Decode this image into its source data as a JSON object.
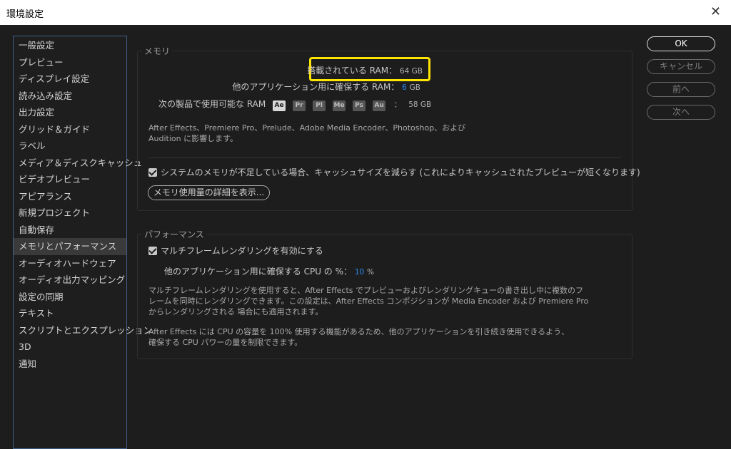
{
  "window": {
    "title": "環境設定"
  },
  "sidebar": {
    "items": [
      {
        "label": "一般設定"
      },
      {
        "label": "プレビュー"
      },
      {
        "label": "ディスプレイ設定"
      },
      {
        "label": "読み込み設定"
      },
      {
        "label": "出力設定"
      },
      {
        "label": "グリッド＆ガイド"
      },
      {
        "label": "ラベル"
      },
      {
        "label": "メディア＆ディスクキャッシュ"
      },
      {
        "label": "ビデオプレビュー"
      },
      {
        "label": "アピアランス"
      },
      {
        "label": "新規プロジェクト"
      },
      {
        "label": "自動保存"
      },
      {
        "label": "メモリとパフォーマンス",
        "selected": true
      },
      {
        "label": "オーディオハードウェア"
      },
      {
        "label": "オーディオ出力マッピング"
      },
      {
        "label": "設定の同期"
      },
      {
        "label": "テキスト"
      },
      {
        "label": "スクリプトとエクスプレッション"
      },
      {
        "label": "3D"
      },
      {
        "label": "通知"
      }
    ]
  },
  "memory": {
    "group_label": "メモリ",
    "installed_ram_label": "搭載されている RAM：",
    "installed_ram_value": "64 GB",
    "reserved_label": "他のアプリケーション用に確保する RAM：",
    "reserved_value": "6",
    "reserved_unit": "GB",
    "available_label": "次の製品で使用可能な RAM",
    "apps": [
      "Ae",
      "Pr",
      "Pl",
      "Me",
      "Ps",
      "Au"
    ],
    "available_sep": "：",
    "available_value": "58 GB",
    "note_line1": "After Effects、Premiere Pro、Prelude、Adobe Media Encoder、Photoshop、および",
    "note_line2": "Audition に影響します。",
    "cache_checkbox_label": "システムのメモリが不足している場合、キャッシュサイズを減らす (これによりキャッシュされたプレビューが短くなります)",
    "details_button": "メモリ使用量の詳細を表示..."
  },
  "performance": {
    "group_label": "パフォーマンス",
    "multiframe_checkbox_label": "マルチフレームレンダリングを有効にする",
    "cpu_label": "他のアプリケーション用に確保する CPU の %：",
    "cpu_value": "10",
    "cpu_unit": "%",
    "para1_line1": "マルチフレームレンダリングを使用すると、After Effects でプレビューおよびレンダリングキューの書き出し中に複数のフ",
    "para1_line2": "レームを同時にレンダリングできます。この設定は、After Effects コンポジションが Media Encoder および Premiere Pro",
    "para1_line3": "からレンダリングされる 場合にも適用されます。",
    "para2_line1": "After Effects には CPU の容量を 100% 使用する機能があるため、他のアプリケーションを引き続き使用できるよう、",
    "para2_line2": "確保する CPU パワーの量を制限できます。"
  },
  "buttons": {
    "ok": "OK",
    "cancel": "キャンセル",
    "prev": "前へ",
    "next": "次へ"
  },
  "colors": {
    "highlight": "#ffe500",
    "accent_value": "#2a8af0",
    "sidebar_border": "#3f5f88"
  }
}
